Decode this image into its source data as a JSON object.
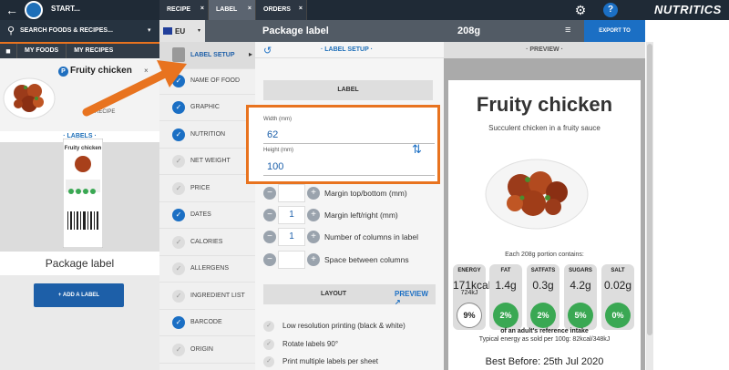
{
  "topbar": {
    "back_icon": "←",
    "start_label": "START...",
    "tabs": [
      {
        "label": "RECIPE",
        "close": "×"
      },
      {
        "label": "LABEL",
        "close": "×"
      },
      {
        "label": "ORDERS",
        "close": "×"
      }
    ],
    "gear_icon": "⚙",
    "help_label": "?",
    "brand": "NUTRITICS"
  },
  "left": {
    "search_placeholder": "SEARCH FOODS & RECIPES...",
    "search_chevron": "▾",
    "my_foods": "MY FOODS",
    "my_recipes": "MY RECIPES",
    "food_badge": "P",
    "food_name": "Fruity chicken",
    "food_close": "×",
    "edit_recipe": "RECIPE",
    "labels_header": "· LABELS ·",
    "thumb_title": "Fruity chicken",
    "package_label": "Package label",
    "add_label": "+ ADD A LABEL"
  },
  "header": {
    "region": "EU",
    "region_chevron": "▾",
    "title": "Package label",
    "weight": "208g",
    "export": "EXPORT TO"
  },
  "sidebar": {
    "items": [
      {
        "label": "LABEL SETUP",
        "checked": false
      },
      {
        "label": "NAME OF FOOD",
        "checked": true
      },
      {
        "label": "GRAPHIC",
        "checked": true
      },
      {
        "label": "NUTRITION",
        "checked": true
      },
      {
        "label": "NET WEIGHT",
        "checked": false
      },
      {
        "label": "PRICE",
        "checked": false
      },
      {
        "label": "DATES",
        "checked": true
      },
      {
        "label": "CALORIES",
        "checked": false
      },
      {
        "label": "ALLERGENS",
        "checked": false
      },
      {
        "label": "INGREDIENT LIST",
        "checked": false
      },
      {
        "label": "BARCODE",
        "checked": true
      },
      {
        "label": "ORIGIN",
        "checked": false
      }
    ],
    "check_mark": "✓"
  },
  "settings": {
    "header": "· LABEL SETUP ·",
    "label_bar": "LABEL",
    "width_label": "Width (mm)",
    "width_value": "62",
    "height_label": "Height (mm)",
    "height_value": "100",
    "steppers": [
      {
        "value": "",
        "label": "Margin top/bottom (mm)"
      },
      {
        "value": "1",
        "label": "Margin left/right (mm)"
      },
      {
        "value": "1",
        "label": "Number of columns in label"
      },
      {
        "value": "",
        "label": "Space between columns"
      }
    ],
    "minus": "−",
    "plus": "+",
    "layout": "LAYOUT",
    "preview_link": "PREVIEW ↗",
    "options": [
      "Low resolution printing (black & white)",
      "Rotate labels 90°",
      "Print multiple labels per sheet"
    ]
  },
  "preview": {
    "header": "· PREVIEW ·",
    "title": "Fruity chicken",
    "subtitle": "Succulent chicken in a fruity sauce",
    "portion": "Each 208g portion contains:",
    "nutrients": [
      {
        "name": "ENERGY",
        "value": "171kcal",
        "value2": "724kJ",
        "pct": "9%",
        "energy": true
      },
      {
        "name": "FAT",
        "value": "1.4g",
        "value2": "",
        "pct": "2%"
      },
      {
        "name": "SATFATS",
        "value": "0.3g",
        "value2": "",
        "pct": "2%"
      },
      {
        "name": "SUGARS",
        "value": "4.2g",
        "value2": "",
        "pct": "5%"
      },
      {
        "name": "SALT",
        "value": "0.02g",
        "value2": "",
        "pct": "0%"
      }
    ],
    "reference": "of an adult's reference intake",
    "typical": "Typical energy as sold per 100g: 82kcal/348kJ",
    "best_before": "Best Before: 25th Jul 2020"
  },
  "colors": {
    "accent_orange": "#e8731f",
    "primary_blue": "#1b6fc4",
    "traffic_green": "#3aa853"
  }
}
